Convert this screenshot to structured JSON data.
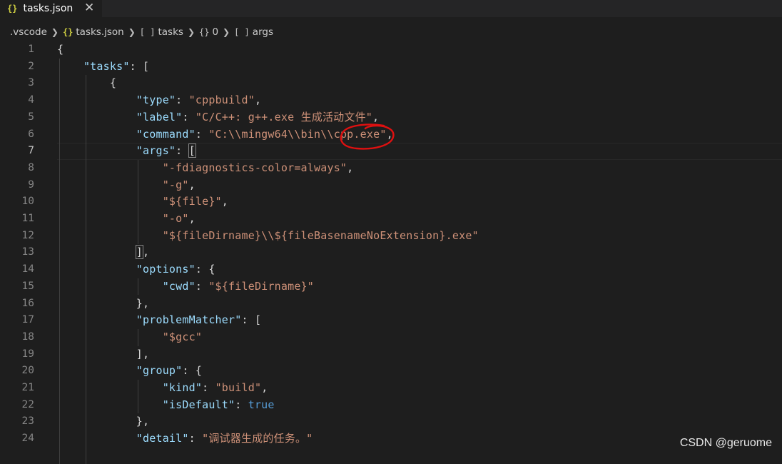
{
  "tab": {
    "icon": "{}",
    "label": "tasks.json",
    "close": "✕"
  },
  "breadcrumb": {
    "folder": ".vscode",
    "file_icon": "{}",
    "file": "tasks.json",
    "arr_icon": "[ ]",
    "tasks": "tasks",
    "obj_icon": "{}",
    "index": "0",
    "arr_icon2": "[ ]",
    "args": "args"
  },
  "editor": {
    "active_line": 7,
    "lines": [
      {
        "n": "1",
        "tokens": [
          [
            "p",
            "{"
          ]
        ]
      },
      {
        "n": "2",
        "tokens": [
          [
            "p",
            "    "
          ],
          [
            "k",
            "\"tasks\""
          ],
          [
            "p",
            ": ["
          ]
        ]
      },
      {
        "n": "3",
        "tokens": [
          [
            "p",
            "        {"
          ]
        ]
      },
      {
        "n": "4",
        "tokens": [
          [
            "p",
            "            "
          ],
          [
            "k",
            "\"type\""
          ],
          [
            "p",
            ": "
          ],
          [
            "s",
            "\"cppbuild\""
          ],
          [
            "p",
            ","
          ]
        ]
      },
      {
        "n": "5",
        "tokens": [
          [
            "p",
            "            "
          ],
          [
            "k",
            "\"label\""
          ],
          [
            "p",
            ": "
          ],
          [
            "s",
            "\"C/C++: g++.exe 生成活动文件\""
          ],
          [
            "p",
            ","
          ]
        ]
      },
      {
        "n": "6",
        "tokens": [
          [
            "p",
            "            "
          ],
          [
            "k",
            "\"command\""
          ],
          [
            "p",
            ": "
          ],
          [
            "s",
            "\"C:\\\\mingw64\\\\bin\\\\cpp.exe\""
          ],
          [
            "p",
            ","
          ]
        ]
      },
      {
        "n": "7",
        "tokens": [
          [
            "p",
            "            "
          ],
          [
            "k",
            "\"args\""
          ],
          [
            "p",
            ": "
          ],
          [
            "bm",
            "["
          ]
        ]
      },
      {
        "n": "8",
        "tokens": [
          [
            "p",
            "                "
          ],
          [
            "s",
            "\"-fdiagnostics-color=always\""
          ],
          [
            "p",
            ","
          ]
        ]
      },
      {
        "n": "9",
        "tokens": [
          [
            "p",
            "                "
          ],
          [
            "s",
            "\"-g\""
          ],
          [
            "p",
            ","
          ]
        ]
      },
      {
        "n": "10",
        "tokens": [
          [
            "p",
            "                "
          ],
          [
            "s",
            "\"${file}\""
          ],
          [
            "p",
            ","
          ]
        ]
      },
      {
        "n": "11",
        "tokens": [
          [
            "p",
            "                "
          ],
          [
            "s",
            "\"-o\""
          ],
          [
            "p",
            ","
          ]
        ]
      },
      {
        "n": "12",
        "tokens": [
          [
            "p",
            "                "
          ],
          [
            "s",
            "\"${fileDirname}\\\\${fileBasenameNoExtension}.exe\""
          ]
        ]
      },
      {
        "n": "13",
        "tokens": [
          [
            "p",
            "            "
          ],
          [
            "bm",
            "]"
          ],
          [
            "p",
            ","
          ]
        ]
      },
      {
        "n": "14",
        "tokens": [
          [
            "p",
            "            "
          ],
          [
            "k",
            "\"options\""
          ],
          [
            "p",
            ": {"
          ]
        ]
      },
      {
        "n": "15",
        "tokens": [
          [
            "p",
            "                "
          ],
          [
            "k",
            "\"cwd\""
          ],
          [
            "p",
            ": "
          ],
          [
            "s",
            "\"${fileDirname}\""
          ]
        ]
      },
      {
        "n": "16",
        "tokens": [
          [
            "p",
            "            },"
          ]
        ]
      },
      {
        "n": "17",
        "tokens": [
          [
            "p",
            "            "
          ],
          [
            "k",
            "\"problemMatcher\""
          ],
          [
            "p",
            ": ["
          ]
        ]
      },
      {
        "n": "18",
        "tokens": [
          [
            "p",
            "                "
          ],
          [
            "s",
            "\"$gcc\""
          ]
        ]
      },
      {
        "n": "19",
        "tokens": [
          [
            "p",
            "            ],"
          ]
        ]
      },
      {
        "n": "20",
        "tokens": [
          [
            "p",
            "            "
          ],
          [
            "k",
            "\"group\""
          ],
          [
            "p",
            ": {"
          ]
        ]
      },
      {
        "n": "21",
        "tokens": [
          [
            "p",
            "                "
          ],
          [
            "k",
            "\"kind\""
          ],
          [
            "p",
            ": "
          ],
          [
            "s",
            "\"build\""
          ],
          [
            "p",
            ","
          ]
        ]
      },
      {
        "n": "22",
        "tokens": [
          [
            "p",
            "                "
          ],
          [
            "k",
            "\"isDefault\""
          ],
          [
            "p",
            ": "
          ],
          [
            "b",
            "true"
          ]
        ]
      },
      {
        "n": "23",
        "tokens": [
          [
            "p",
            "            },"
          ]
        ]
      },
      {
        "n": "24",
        "tokens": [
          [
            "p",
            "            "
          ],
          [
            "k",
            "\"detail\""
          ],
          [
            "p",
            ": "
          ],
          [
            "s",
            "\"调试器生成的任务。\""
          ]
        ]
      }
    ]
  },
  "watermark": "CSDN @geruome",
  "colors": {
    "background": "#1e1e1e",
    "key": "#9cdcfe",
    "string": "#ce9178",
    "boolean": "#569cd6",
    "json_icon": "#cbcb41",
    "annotation": "#e01010"
  }
}
